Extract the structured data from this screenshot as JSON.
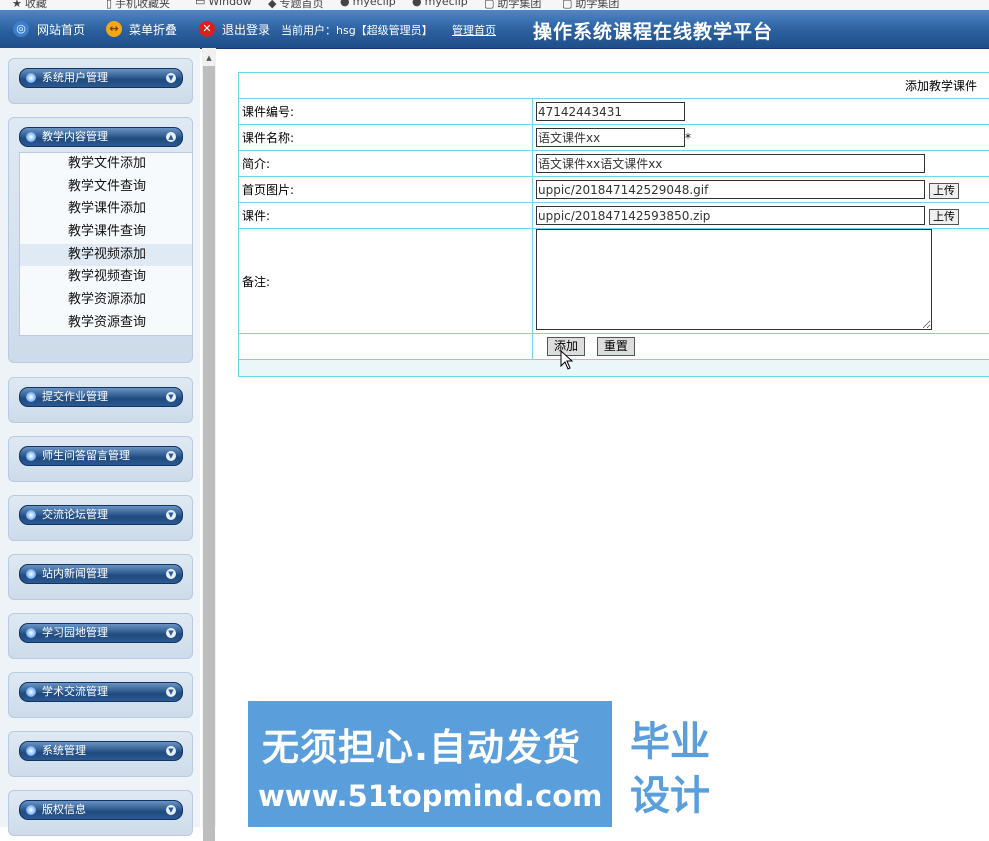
{
  "bookmarks": [
    {
      "label": "收藏",
      "icon": "star-icon"
    },
    {
      "label": "手机收藏夹",
      "icon": "phone-icon"
    },
    {
      "label": "Window",
      "icon": "folder-icon"
    },
    {
      "label": "专题首页",
      "icon": "page-icon"
    },
    {
      "label": "myeclip",
      "icon": "eclipse-icon"
    },
    {
      "label": "myeclip",
      "icon": "eclipse-icon"
    },
    {
      "label": "助学集团",
      "icon": "page-icon"
    },
    {
      "label": "助学集团",
      "icon": "page-icon"
    }
  ],
  "topbar": {
    "home": "网站首页",
    "collapse": "菜单折叠",
    "logout": "退出登录",
    "user": "当前用户：hsg【超级管理员】",
    "admin_home": "管理首页",
    "title": "操作系统课程在线教学平台"
  },
  "sidebar": {
    "groups": [
      {
        "label": "系统用户管理"
      },
      {
        "label": "教学内容管理",
        "items": [
          "教学文件添加",
          "教学文件查询",
          "教学课件添加",
          "教学课件查询",
          "教学视频添加",
          "教学视频查询",
          "教学资源添加",
          "教学资源查询"
        ],
        "active_index": 4
      },
      {
        "label": "提交作业管理"
      },
      {
        "label": "师生问答留言管理"
      },
      {
        "label": "交流论坛管理"
      },
      {
        "label": "站内新闻管理"
      },
      {
        "label": "学习园地管理"
      },
      {
        "label": "学术交流管理"
      },
      {
        "label": "系统管理"
      },
      {
        "label": "版权信息"
      }
    ]
  },
  "form": {
    "title": "添加教学课件",
    "rows": {
      "code_label": "课件编号:",
      "code_value": "47142443431",
      "name_label": "课件名称:",
      "name_value": "语文课件xx",
      "required_mark": "*",
      "intro_label": "简介:",
      "intro_value": "语文课件xx语文课件xx",
      "image_label": "首页图片:",
      "image_value": "uppic/201847142529048.gif",
      "file_label": "课件:",
      "file_value": "uppic/201847142593850.zip",
      "remark_label": "备注:",
      "upload_label": "上传"
    },
    "add_label": "添加",
    "reset_label": "重置"
  },
  "watermark": {
    "line1": "无须担心.自动发货",
    "line2": "www.51topmind.com",
    "box1": "毕业",
    "box2": "设计"
  },
  "colors": {
    "topbar": "#2b5f9e",
    "table_border": "#6fd6e6",
    "watermark": "#5a9fdc"
  }
}
